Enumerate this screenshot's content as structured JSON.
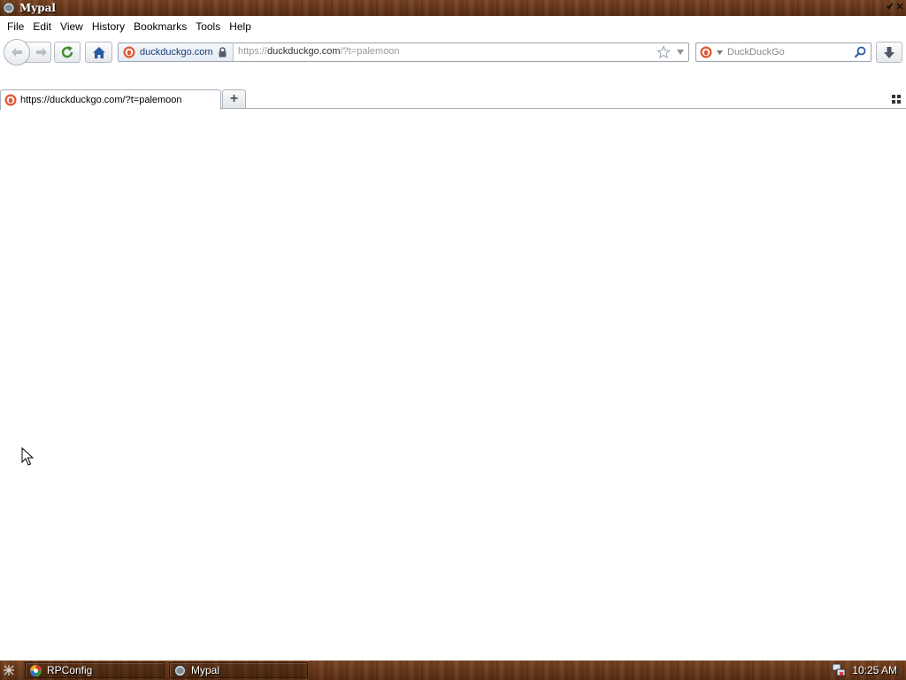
{
  "window": {
    "title": "Mypal",
    "controls": [
      "✔",
      "✕"
    ]
  },
  "menu": {
    "items": [
      {
        "label": "File"
      },
      {
        "label": "Edit"
      },
      {
        "label": "View"
      },
      {
        "label": "History"
      },
      {
        "label": "Bookmarks"
      },
      {
        "label": "Tools"
      },
      {
        "label": "Help"
      }
    ]
  },
  "navbar": {
    "identity_label": "duckduckgo.com",
    "url_prefix": "https://",
    "url_host": "duckduckgo.com",
    "url_suffix": "/?t=palemoon",
    "search_placeholder": "DuckDuckGo"
  },
  "tabs": {
    "items": [
      {
        "label": "https://duckduckgo.com/?t=palemoon",
        "active": true
      }
    ],
    "new_tab_symbol": "+"
  },
  "taskbar": {
    "tasks": [
      {
        "label": "RPConfig"
      },
      {
        "label": "Mypal"
      }
    ],
    "clock": "10:25 AM"
  },
  "colors": {
    "accent_blue": "#2a5aa8",
    "ddg_orange": "#de5833",
    "wood_brown": "#6b3a1c"
  }
}
